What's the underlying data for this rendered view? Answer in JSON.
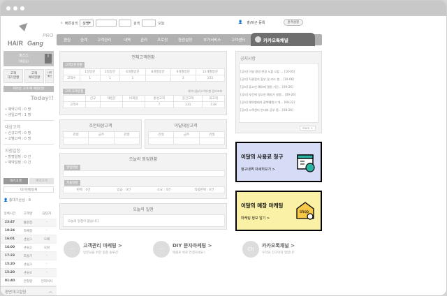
{
  "window": {
    "dots": [
      "",
      "",
      ""
    ]
  },
  "logo": {
    "pro": "PRO",
    "hair": "HAIR",
    "gang": "Gang"
  },
  "topbar": {
    "search_label": "빠른검색",
    "select_value": "성명",
    "search_btn": "검색",
    "reset_btn": "오늘",
    "attendance": "출/퇴근 등록",
    "attendance_btn": "원격설정"
  },
  "nav": {
    "items": [
      "편집",
      "승계",
      "고객관리",
      "내역",
      "관리",
      "프로정",
      "환경설정",
      "부가서비스",
      "고객센터"
    ],
    "active": "카카오톡채널"
  },
  "left": {
    "store": "퍼스스",
    "store_sub": "(매장님)",
    "btn1": "고객\n대기현황",
    "btn2": "고객\n예약현황",
    "btn3": "나의\n예산",
    "banner": "헤어상 고객 예 예정(정)",
    "today": "Today!!",
    "sec1": [
      "• 예약고객 : 0 명",
      "• 생일고객 : 1 명"
    ],
    "sec2_title": "대상고객",
    "sec2": [
      "• 신규고객 : 0 명",
      "• 고별고객 : 0 명"
    ],
    "sec3_title": "지점일정",
    "sec3": [
      "• 방명일정 : 0 건",
      "• 예약일정 : 0 건"
    ],
    "tabs": [
      "대기고객",
      "예약고객"
    ],
    "more": "대기현황등록",
    "waiting": "총대기손님 : 8",
    "cols": [
      "등록시간",
      "고객명",
      "담당자"
    ],
    "rows": [
      [
        "23:47",
        "통원장",
        "-"
      ],
      [
        "10:24",
        "차예정",
        "-"
      ],
      [
        "16:01",
        "손님1",
        "오페"
      ],
      [
        "16:00",
        "손님2",
        "오원"
      ],
      [
        "17:23",
        "조솔기",
        "-"
      ],
      [
        "15:20",
        "손님3",
        "-"
      ],
      [
        "15:20",
        "손님4",
        "-"
      ],
      [
        "01:40",
        "안정랑",
        "인라이사"
      ]
    ],
    "footer": "판면재고알림"
  },
  "summary": {
    "title": "전체고객현황",
    "tag1": "고객방문현황",
    "head1": [
      "",
      "1일방문",
      "3일방문",
      "6개월방문",
      "8개월방문",
      "9개월방문",
      "12개월방문"
    ],
    "row1": [
      "고객수",
      "1",
      "1",
      "1",
      "",
      "3",
      "155"
    ],
    "tag2": "고객 고객유형",
    "note2": "헤어디솔라고객유형 관리조회",
    "head2": [
      "",
      "신규",
      "재방문",
      "비회원",
      "충성고객",
      "중간고객",
      "휴고객"
    ],
    "row2": [
      "고객수",
      "",
      "",
      "",
      "7",
      "131",
      "138"
    ]
  },
  "care": {
    "title": "조언대상고객",
    "cols": [
      "관절",
      "금주",
      "관절"
    ]
  },
  "birthday": {
    "title": "이달대상고객",
    "cols": [
      "관절",
      "금주",
      "관절"
    ]
  },
  "sales": {
    "title": "오늘의 영업현황",
    "tag1": "영업현황",
    "tag2": "지출현황",
    "footer": [
      "판매 : 0건",
      "입금 : 0건",
      "소요 : 0건",
      "적립판매 : 0건"
    ]
  },
  "schedule": {
    "title": "오늘의 일정",
    "empty": "오늘의 일정이 없습니다."
  },
  "notice": {
    "title": "공지사항",
    "items": [
      "[공지] 이달 환경 변경 노출 오류 ... [10-05]",
      "[공지] 직관정지 할부 및 카드 층... [10-06]",
      "[공지] 휴고인 예외에 결원 기간... [09-26]",
      "[공지] 보건에 경고인 예외가 설명... [09-26]",
      "[공지] 예약형태의 관책예원고 개... [09-22]",
      "[공지] 고객센터 안내자 공부 중... [08-28]"
    ],
    "more": "more +"
  },
  "ad1": {
    "title": "이달의 사용료 청구",
    "sub": "청구내역 자세히보기 >"
  },
  "ad2": {
    "title": "이달의 매장 마케팅",
    "sub": "마케팅 정보 알기 >",
    "shop": "shop"
  },
  "bottom": [
    {
      "icon": "···",
      "title": "고객관리 마케팅 >",
      "sub": "방문님을 위한 맞춤 솔루션"
    },
    {
      "icon": "···",
      "title": "DIY 문자마케팅 >",
      "sub": "매출로 바로 연결하세요!"
    },
    {
      "icon": "Ch",
      "title": "카카오톡채널 >",
      "sub": "우리와 친구아직 맺었나?"
    }
  ],
  "colors": {
    "nav": "#b0b0b0",
    "active": "#6e6e6e",
    "ad1": "#d6dcf5",
    "ad2": "#fbf1a6"
  }
}
